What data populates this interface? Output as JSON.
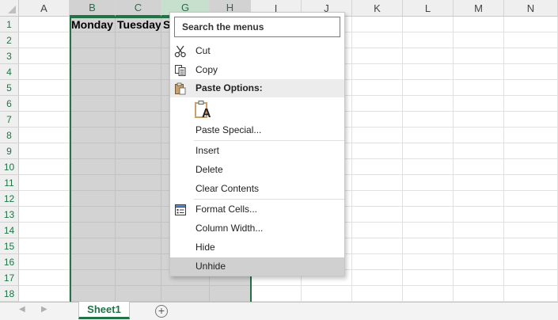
{
  "grid": {
    "columns": [
      "A",
      "B",
      "C",
      "G",
      "H",
      "I",
      "J",
      "K",
      "L",
      "M",
      "N"
    ],
    "rows": [
      "1",
      "2",
      "3",
      "4",
      "5",
      "6",
      "7",
      "8",
      "9",
      "10",
      "11",
      "12",
      "13",
      "14",
      "15",
      "16",
      "17",
      "18"
    ],
    "cells": {
      "B1": "Monday",
      "C1": "Tuesday",
      "G1": "S"
    },
    "selected_columns": [
      "B",
      "C",
      "G",
      "H"
    ]
  },
  "context_menu": {
    "search_placeholder": "Search the menus",
    "items": [
      {
        "label": "Cut",
        "icon": "scissors-icon"
      },
      {
        "label": "Copy",
        "icon": "copy-icon"
      },
      {
        "label": "Paste Options:",
        "icon": "paste-icon"
      },
      {
        "label": "Paste Special...",
        "icon": ""
      },
      {
        "label": "Insert",
        "icon": ""
      },
      {
        "label": "Delete",
        "icon": ""
      },
      {
        "label": "Clear Contents",
        "icon": ""
      },
      {
        "label": "Format Cells...",
        "icon": "format-cells-icon"
      },
      {
        "label": "Column Width...",
        "icon": ""
      },
      {
        "label": "Hide",
        "icon": ""
      },
      {
        "label": "Unhide",
        "icon": ""
      }
    ],
    "paste_option_glyph": "A",
    "highlighted_item": "Unhide"
  },
  "sheet_tabs": {
    "tabs": [
      "Sheet1"
    ],
    "active": "Sheet1",
    "add_glyph": "+",
    "prev_glyph": "◀",
    "next_glyph": "▶"
  },
  "colors": {
    "accent": "#217346",
    "selection": "#d3d3d3",
    "menu_highlight": "#d0d0d0"
  }
}
